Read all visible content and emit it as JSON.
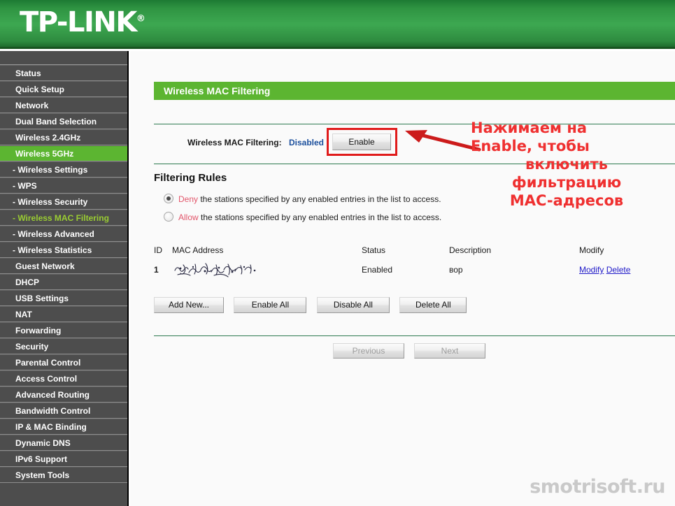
{
  "brand": {
    "name": "TP-LINK",
    "registered_mark": "®"
  },
  "sidebar": {
    "items": [
      {
        "label": "Status",
        "sub": false,
        "state": "normal"
      },
      {
        "label": "Quick Setup",
        "sub": false,
        "state": "normal"
      },
      {
        "label": "Network",
        "sub": false,
        "state": "normal"
      },
      {
        "label": "Dual Band Selection",
        "sub": false,
        "state": "normal"
      },
      {
        "label": "Wireless 2.4GHz",
        "sub": false,
        "state": "normal"
      },
      {
        "label": "Wireless 5GHz",
        "sub": false,
        "state": "selected"
      },
      {
        "label": "- Wireless Settings",
        "sub": true,
        "state": "normal"
      },
      {
        "label": "- WPS",
        "sub": true,
        "state": "normal"
      },
      {
        "label": "- Wireless Security",
        "sub": true,
        "state": "normal"
      },
      {
        "label": "- Wireless MAC Filtering",
        "sub": true,
        "state": "current"
      },
      {
        "label": "- Wireless Advanced",
        "sub": true,
        "state": "normal"
      },
      {
        "label": "- Wireless Statistics",
        "sub": true,
        "state": "normal"
      },
      {
        "label": "Guest Network",
        "sub": false,
        "state": "normal"
      },
      {
        "label": "DHCP",
        "sub": false,
        "state": "normal"
      },
      {
        "label": "USB Settings",
        "sub": false,
        "state": "normal"
      },
      {
        "label": "NAT",
        "sub": false,
        "state": "normal"
      },
      {
        "label": "Forwarding",
        "sub": false,
        "state": "normal"
      },
      {
        "label": "Security",
        "sub": false,
        "state": "normal"
      },
      {
        "label": "Parental Control",
        "sub": false,
        "state": "normal"
      },
      {
        "label": "Access Control",
        "sub": false,
        "state": "normal"
      },
      {
        "label": "Advanced Routing",
        "sub": false,
        "state": "normal"
      },
      {
        "label": "Bandwidth Control",
        "sub": false,
        "state": "normal"
      },
      {
        "label": "IP & MAC Binding",
        "sub": false,
        "state": "normal"
      },
      {
        "label": "Dynamic DNS",
        "sub": false,
        "state": "normal"
      },
      {
        "label": "IPv6 Support",
        "sub": false,
        "state": "normal"
      },
      {
        "label": "System Tools",
        "sub": false,
        "state": "normal"
      }
    ]
  },
  "page": {
    "title": "Wireless MAC Filtering",
    "status_label": "Wireless MAC Filtering:",
    "status_value": "Disabled",
    "enable_button": "Enable"
  },
  "filtering_rules": {
    "heading": "Filtering Rules",
    "options": [
      {
        "keyword": "Deny",
        "rest": " the stations specified by any enabled entries in the list to access.",
        "selected": true
      },
      {
        "keyword": "Allow",
        "rest": " the stations specified by any enabled entries in the list to access.",
        "selected": false
      }
    ]
  },
  "table": {
    "headers": {
      "id": "ID",
      "mac": "MAC Address",
      "status": "Status",
      "description": "Description",
      "modify": "Modify"
    },
    "row": {
      "id": "1",
      "mac": "",
      "status": "Enabled",
      "description": "вор",
      "modify_link": "Modify",
      "delete_link": "Delete"
    }
  },
  "actions": {
    "add_new": "Add New...",
    "enable_all": "Enable All",
    "disable_all": "Disable All",
    "delete_all": "Delete All"
  },
  "pagination": {
    "previous": "Previous",
    "next": "Next"
  },
  "annotation": {
    "line1": "Нажимаем на",
    "line2": "Enable, чтобы",
    "line3": "включить",
    "line4": "фильтрацию",
    "line5": "MAC-адресов"
  },
  "watermark": "smotrisoft.ru",
  "colors": {
    "brand_green": "#3da851",
    "accent_green": "#5cb531",
    "sidebar_bg": "#4d4d4d",
    "sidebar_active_text": "#9acd32",
    "link_blue": "#1e18c8",
    "status_blue": "#1b4f9c",
    "annotation_red": "#ef3030",
    "highlight_red": "#e01b1b",
    "keyword_pink": "#e2556a"
  }
}
